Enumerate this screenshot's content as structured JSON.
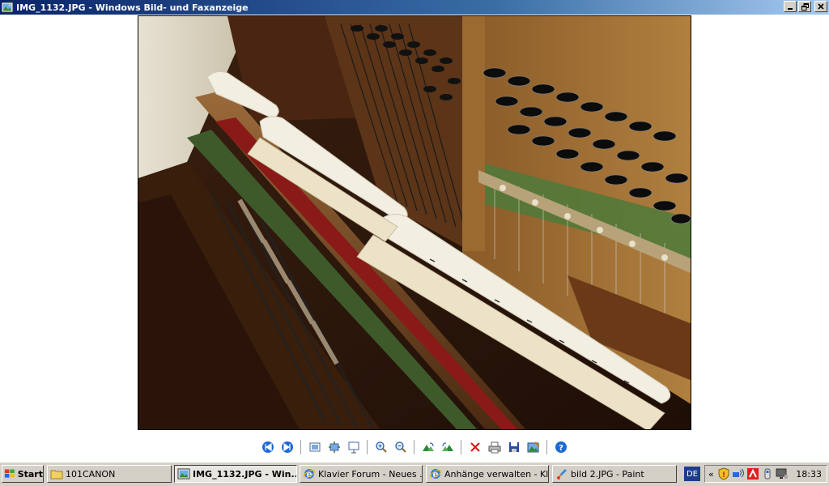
{
  "window": {
    "title": "IMG_1132.JPG - Windows Bild- und Faxanzeige",
    "minimize_icon": "minimize-icon",
    "restore_icon": "restore-icon",
    "close_icon": "close-icon"
  },
  "toolbar": {
    "buttons": [
      {
        "name": "previous-image-button",
        "icon": "previous-icon"
      },
      {
        "name": "next-image-button",
        "icon": "next-icon"
      },
      {
        "name": "best-fit-button",
        "icon": "best-fit-icon"
      },
      {
        "name": "actual-size-button",
        "icon": "actual-size-icon"
      },
      {
        "name": "slideshow-button",
        "icon": "slideshow-icon"
      },
      {
        "name": "zoom-in-button",
        "icon": "zoom-in-icon"
      },
      {
        "name": "zoom-out-button",
        "icon": "zoom-out-icon"
      },
      {
        "name": "rotate-clockwise-button",
        "icon": "rotate-clockwise-icon"
      },
      {
        "name": "rotate-counterclockwise-button",
        "icon": "rotate-counterclockwise-icon"
      },
      {
        "name": "delete-button",
        "icon": "delete-icon"
      },
      {
        "name": "print-button",
        "icon": "print-icon"
      },
      {
        "name": "save-button",
        "icon": "save-icon"
      },
      {
        "name": "edit-button",
        "icon": "edit-icon"
      },
      {
        "name": "help-button",
        "icon": "help-icon"
      }
    ]
  },
  "taskbar": {
    "start_label": "Start",
    "tasks": [
      {
        "label": "101CANON",
        "icon": "folder-icon",
        "active": false
      },
      {
        "label": "IMG_1132.JPG - Win...",
        "icon": "image-viewer-icon",
        "active": true
      },
      {
        "label": "Klavier Forum - Neues ...",
        "icon": "internet-explorer-icon",
        "active": false
      },
      {
        "label": "Anhänge verwalten - Kl...",
        "icon": "internet-explorer-icon",
        "active": false
      },
      {
        "label": "bild 2.JPG - Paint",
        "icon": "paint-icon",
        "active": false
      }
    ],
    "language": "DE",
    "tray_chevron": "«",
    "clock": "18:33"
  },
  "colors": {
    "title_gradient_start": "#0a246a",
    "title_gradient_end": "#a6caf0",
    "taskbar_bg": "#d4d0c8"
  }
}
